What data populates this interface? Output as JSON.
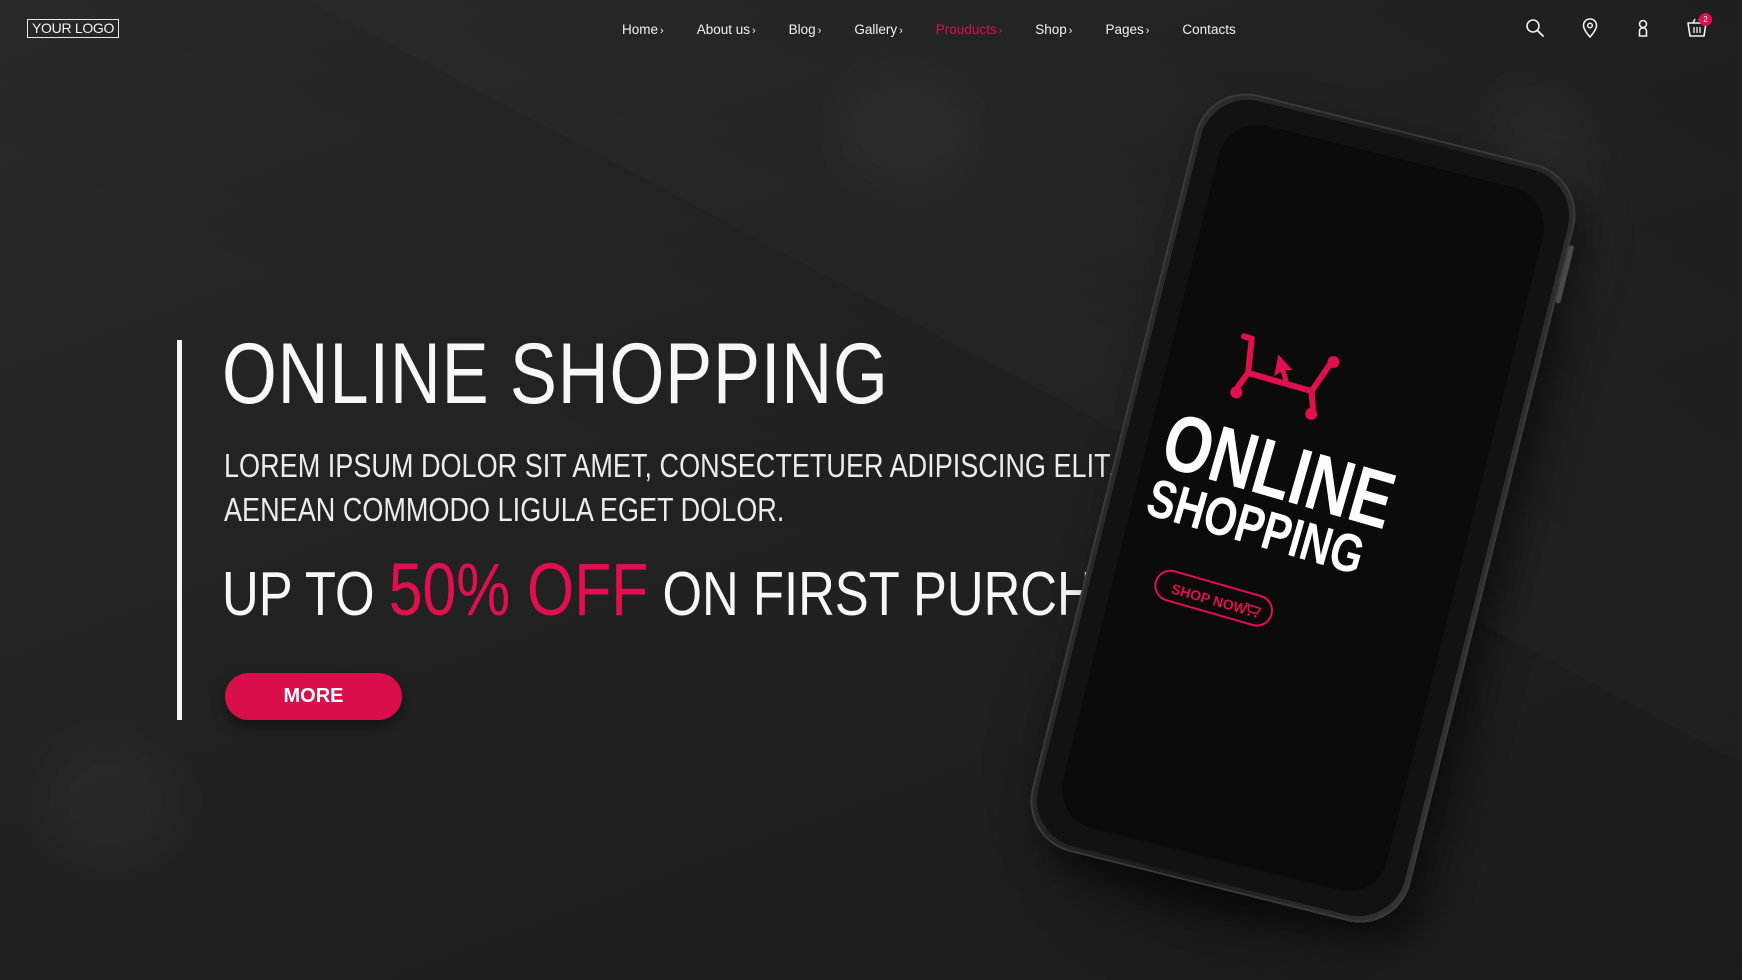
{
  "header": {
    "logo": "YOUR LOGO",
    "nav": [
      {
        "label": "Home",
        "caret": "›"
      },
      {
        "label": "About us",
        "caret": "›"
      },
      {
        "label": "Blog",
        "caret": "›"
      },
      {
        "label": "Gallery",
        "caret": "›"
      },
      {
        "label": "Prouducts",
        "caret": "›",
        "active": true
      },
      {
        "label": "Shop",
        "caret": "›"
      },
      {
        "label": "Pages",
        "caret": "›"
      },
      {
        "label": "Contacts",
        "caret": ""
      }
    ],
    "icons": [
      "search-icon",
      "location-pin-icon",
      "user-icon",
      "cart-icon"
    ],
    "cart_count": "2"
  },
  "hero": {
    "title": "ONLINE SHOPPING",
    "subtitle_line1": "LOREM IPSUM DOLOR SIT AMET, CONSECTETUER ADIPISCING ELIT.",
    "subtitle_line2": "AENEAN COMMODO LIGULA EGET DOLOR.",
    "offer_prefix": "UP TO ",
    "offer_accent": "50% OFF",
    "offer_suffix": " ON FIRST PURCHASE",
    "button_label": "MORE"
  },
  "phone": {
    "screen_line1": "ONLINE",
    "screen_line2": "SHOPPING",
    "shop_now": "SHOP NOW"
  },
  "colors": {
    "accent": "#e0104f",
    "background": "#1f1f20",
    "text": "#f7f7f7"
  }
}
